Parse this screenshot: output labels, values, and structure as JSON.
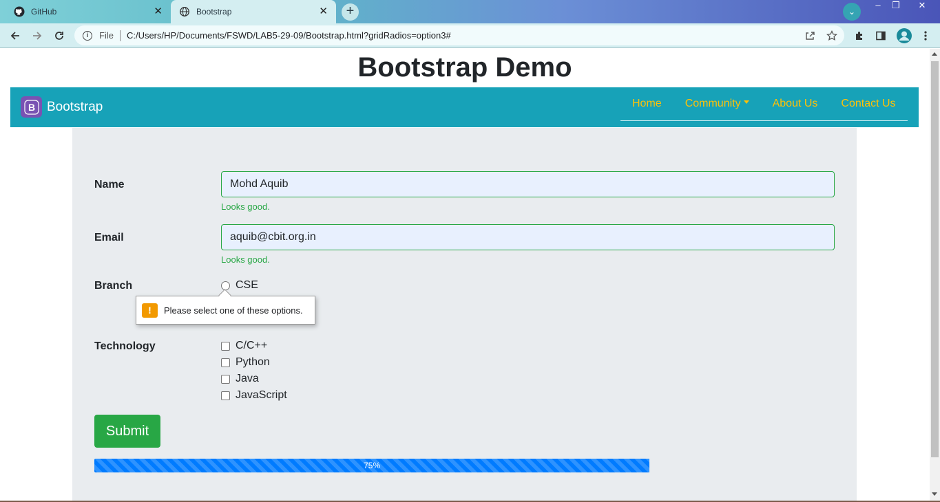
{
  "browser": {
    "tabs": [
      {
        "title": "GitHub",
        "icon": "github-icon",
        "active": false
      },
      {
        "title": "Bootstrap",
        "icon": "globe-icon",
        "active": true
      }
    ],
    "new_tab": "+",
    "address": {
      "file_label": "File",
      "url": "C:/Users/HP/Documents/FSWD/LAB5-29-09/Bootstrap.html?gridRadios=option3#"
    }
  },
  "page": {
    "title": "Bootstrap Demo",
    "navbar": {
      "brand": "Bootstrap",
      "brand_letter": "B",
      "links": [
        {
          "label": "Home"
        },
        {
          "label": "Community",
          "dropdown": true
        },
        {
          "label": "About Us"
        },
        {
          "label": "Contact Us"
        }
      ],
      "link_color": "#ffc107",
      "bg_color": "#17a2b8"
    },
    "form": {
      "name": {
        "label": "Name",
        "value": "Mohd Aquib",
        "feedback": "Looks good."
      },
      "email": {
        "label": "Email",
        "value": "aquib@cbit.org.in",
        "feedback": "Looks good."
      },
      "branch": {
        "label": "Branch",
        "options": [
          "CSE"
        ]
      },
      "validation_tooltip": "Please select one of these options.",
      "technology": {
        "label": "Technology",
        "options": [
          "C/C++",
          "Python",
          "Java",
          "JavaScript"
        ]
      },
      "submit_label": "Submit",
      "progress": {
        "value": 75,
        "label": "75%"
      }
    }
  }
}
